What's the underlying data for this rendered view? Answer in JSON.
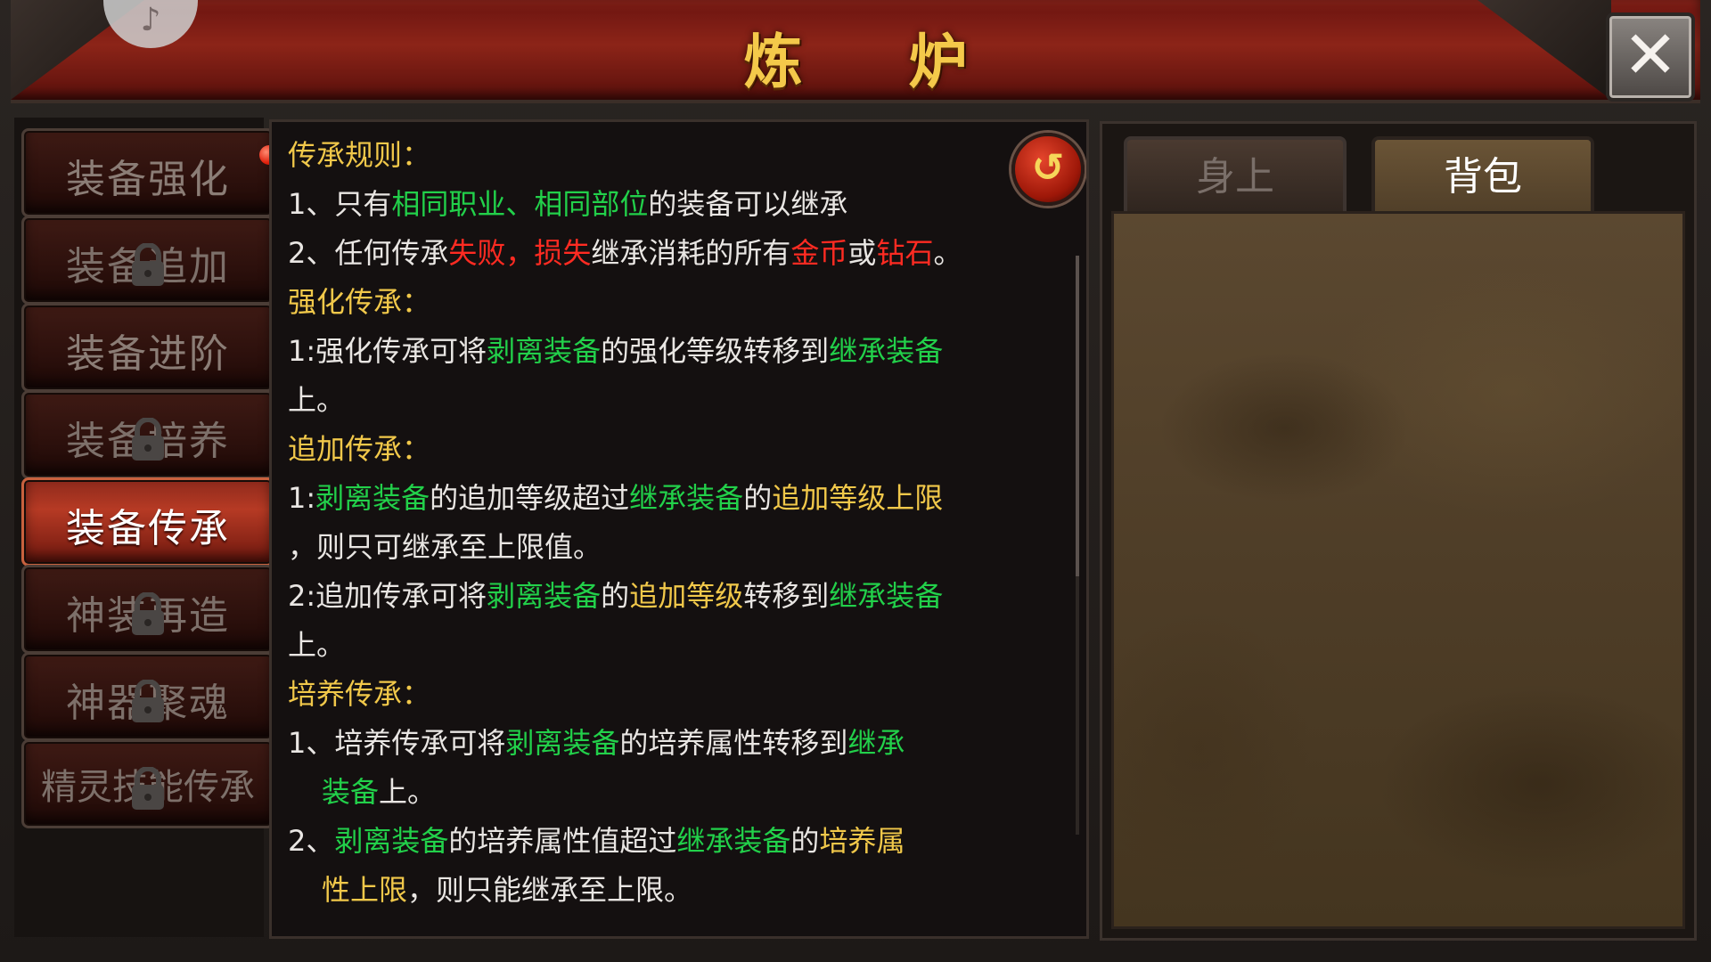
{
  "window": {
    "title": "炼 炉",
    "close_label": "✕",
    "avatar_glyph": "♪"
  },
  "menu": {
    "items": [
      {
        "label": "装备强化",
        "locked": false,
        "active": false,
        "badge": true
      },
      {
        "label": "装备追加",
        "locked": true,
        "active": false,
        "badge": false
      },
      {
        "label": "装备进阶",
        "locked": false,
        "active": false,
        "badge": false
      },
      {
        "label": "装备培养",
        "locked": true,
        "active": false,
        "badge": false
      },
      {
        "label": "装备传承",
        "locked": false,
        "active": true,
        "badge": false
      },
      {
        "label": "神装再造",
        "locked": true,
        "active": false,
        "badge": false
      },
      {
        "label": "神器聚魂",
        "locked": true,
        "active": false,
        "badge": false
      },
      {
        "label": "精灵技能传承",
        "locked": true,
        "active": false,
        "badge": false
      }
    ]
  },
  "info": {
    "back_label": "↺",
    "rules_title": "传承规则：",
    "rule1": {
      "a": "1、只有",
      "b": "相同职业、相同部位",
      "c": "的装备可以继承"
    },
    "rule2": {
      "a": "2、任何传承",
      "b": "失败，损失",
      "c": "继承消耗的所有",
      "d": "金币",
      "e": "或",
      "f": "钻石",
      "g": "。"
    },
    "strengthen_title": "强化传承：",
    "s1": {
      "a": "1:强化传承可将",
      "b": "剥离装备",
      "c": "的强化等级转移到",
      "d": "继承装备",
      "e": "上。"
    },
    "add_title": "追加传承：",
    "a1": {
      "a": "1:",
      "b": "剥离装备",
      "c": "的追加等级超过",
      "d": "继承装备",
      "e": "的",
      "f": "追加等级上限",
      "g": "，则只可继承至上限值。"
    },
    "a2": {
      "a": "2:追加传承可将",
      "b": "剥离装备",
      "c": "的",
      "d": "追加等级",
      "e": "转移到",
      "f": "继承装备",
      "g": "上。"
    },
    "train_title": "培养传承：",
    "t1": {
      "a": "1、培养传承可将",
      "b": "剥离装备",
      "c": "的培养属性转移到",
      "d": "继承",
      "e": "装备",
      "f": "上。"
    },
    "t2": {
      "a": "2、",
      "b": "剥离装备",
      "c": "的培养属性值超过",
      "d": "继承装备",
      "e": "的",
      "f": "培养属",
      "g": "性上限",
      "h": "，则只能继承至上限。"
    }
  },
  "rpanel": {
    "tabs": [
      {
        "label": "身上",
        "active": false
      },
      {
        "label": "背包",
        "active": true
      }
    ]
  },
  "colors": {
    "green": "#22d04a",
    "red": "#ff2b22",
    "gold": "#f1c84a"
  }
}
